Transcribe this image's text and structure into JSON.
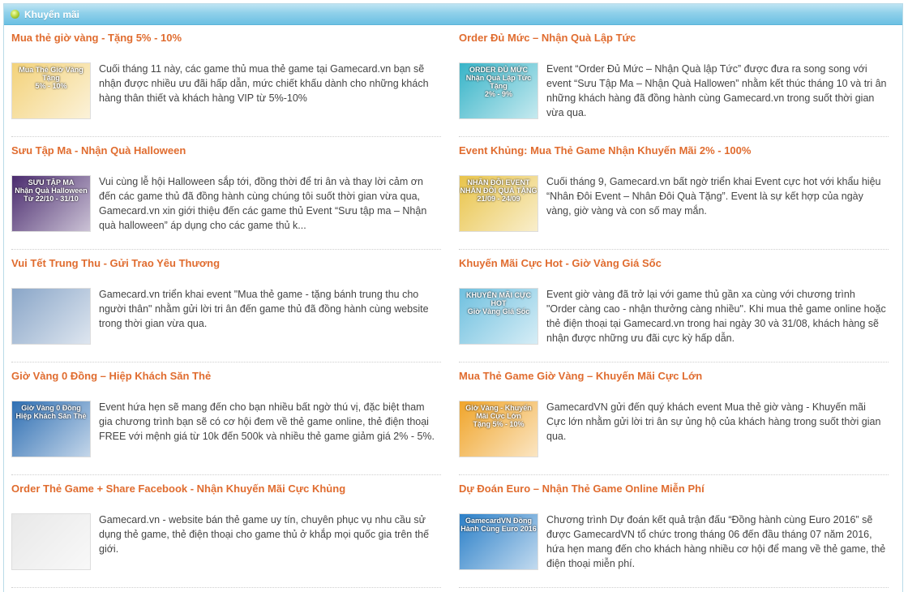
{
  "panel": {
    "title": "Khuyến mãi"
  },
  "colors": {
    "header": "#7cc7e6",
    "title": "#e06c2f",
    "text": "#444444"
  },
  "items": [
    {
      "title": "Mua thẻ giờ vàng - Tặng 5% - 10%",
      "desc": "Cuối tháng 11 này, các game thủ mua thẻ game tại Gamecard.vn bạn sẽ nhận được nhiều ưu đãi hấp dẫn, mức chiết khấu dành cho những khách hàng thân thiết và khách hàng VIP từ 5%-10%",
      "thumb_text": "Mua Thẻ Giờ Vàng\nTặng\n5% - 10%",
      "thumb_bg": "#f3d27a"
    },
    {
      "title": "Order Đủ Mức – Nhận Quà Lập Tức",
      "desc": "Event “Order Đủ Mức – Nhận Quà lập Tức” được đưa ra song song với event “Sưu Tập Ma – Nhận Quà Hallowen” nhằm kết thúc tháng 10 và tri ân những khách hàng đã đồng hành cùng Gamecard.vn trong suốt thời gian vừa qua.",
      "thumb_text": "ORDER ĐỦ MỨC\nNhận Quà Lập Tức\nTặng\n2% - 9%",
      "thumb_bg": "#37b4c8"
    },
    {
      "title": "Sưu Tập Ma - Nhận Quà Halloween",
      "desc": "Vui cùng lễ hội Halloween sắp tới, đồng thời để tri ân và thay lời cảm ơn đến các game thủ đã đồng hành cùng chúng tôi suốt thời gian vừa qua, Gamecard.vn xin giới thiệu đến các game thủ Event “Sưu tập ma – Nhận quà halloween” áp dụng cho các game thủ k...",
      "thumb_text": "SƯU TẬP MA\nNhận Quà Halloween\nTừ 22/10 - 31/10",
      "thumb_bg": "#4a2b6e"
    },
    {
      "title": "Event Khủng: Mua Thẻ Game Nhận Khuyến Mãi 2% - 100%",
      "desc": "Cuối tháng 9, Gamecard.vn bất ngờ triển khai Event cực hot với khẩu hiệu “Nhân Đôi Event – Nhân Đôi Quà Tặng”. Event là sự kết hợp của ngày vàng, giờ vàng và con số may mắn.",
      "thumb_text": "NHÂN ĐÔI EVENT\nNHÂN ĐÔI QUÀ TẶNG\n21/09 - 24/09",
      "thumb_bg": "#e9c44a"
    },
    {
      "title": "Vui Tết Trung Thu - Gửi Trao Yêu Thương",
      "desc": "Gamecard.vn triển khai event \"Mua thẻ game - tặng bánh trung thu cho người thân\" nhằm gửi lời tri ân đến game thủ đã đồng hành cùng website trong thời gian vừa qua.",
      "thumb_text": "",
      "thumb_bg": "#8aa6c8"
    },
    {
      "title": "Khuyến Mãi Cực Hot - Giờ Vàng Giá Sốc",
      "desc": "Event giờ vàng đã trở lại với game thủ gần xa cùng với chương trình \"Order càng cao - nhận thưởng càng nhiều\". Khi mua thẻ game online hoặc thẻ điện thoại tại Gamecard.vn trong hai ngày 30 và 31/08, khách hàng sẽ nhận được những ưu đãi cực kỳ hấp dẫn.",
      "thumb_text": "KHUYẾN MÃI CỰC HOT\nGiờ Vàng Giá Sốc",
      "thumb_bg": "#6fc0df"
    },
    {
      "title": "Giờ Vàng 0 Đồng – Hiệp Khách Săn Thẻ",
      "desc": "Event hứa hẹn sẽ mang đến cho bạn nhiều bất ngờ thú vị, đặc biệt tham gia chương trình bạn sẽ có cơ hội đem về thẻ game online, thẻ điện thoại FREE với mệnh giá từ 10k đến 500k và nhiều thẻ game giảm giá 2% - 5%.",
      "thumb_text": "Giờ Vàng 0 Đồng\nHiệp Khách Săn Thẻ",
      "thumb_bg": "#2f6fb3"
    },
    {
      "title": "Mua Thẻ Game Giờ Vàng – Khuyến Mãi Cực Lớn",
      "desc": "GamecardVN gửi đến quý khách event Mua thẻ giờ vàng - Khuyến mãi Cực lớn nhằm gửi lời tri ân sự ủng hộ của khách hàng trong suốt thời gian qua.",
      "thumb_text": "Giờ Vàng - Khuyến Mãi Cực Lớn\nTặng 5% - 10%",
      "thumb_bg": "#f0a52b"
    },
    {
      "title": "Order Thẻ Game + Share Facebook - Nhận Khuyến Mãi Cực Khủng",
      "desc": "Gamecard.vn - website bán thẻ game uy tín, chuyên phục vụ nhu cầu sử dụng thẻ game, thẻ điện thoại cho game thủ ở khắp mọi quốc gia trên thế giới.",
      "thumb_text": "",
      "thumb_bg": "#e8e8e8"
    },
    {
      "title": "Dự Đoán Euro – Nhận Thẻ Game Online Miễn Phí",
      "desc": "Chương trình Dự đoán kết quả trận đấu “Đồng hành cùng Euro 2016” sẽ được GamecardVN tổ chức trong tháng 06 đến đầu tháng 07 năm 2016, hứa hẹn mang đến cho khách hàng nhiều cơ hội để mang về thẻ game, thẻ điện thoại miễn phí.",
      "thumb_text": "GamecardVN Đồng Hành Cùng Euro 2016",
      "thumb_bg": "#2a7fc8"
    }
  ]
}
